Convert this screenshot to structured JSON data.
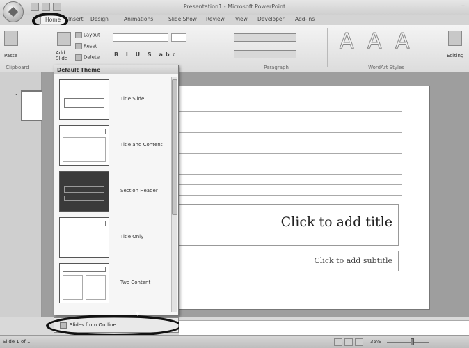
{
  "app": {
    "window_title": "Presentation1 - Microsoft PowerPoint"
  },
  "tabs": [
    "Home",
    "Insert",
    "Design",
    "Animations",
    "Slide Show",
    "Review",
    "View",
    "Developer",
    "Add-Ins"
  ],
  "ribbon": {
    "paste_label": "Paste",
    "add_slide_label": "Add Slide",
    "layout_label": "Layout",
    "reset_label": "Reset",
    "delete_label": "Delete",
    "group_labels": [
      "Clipboard",
      "Paragraph",
      "WordArt Styles"
    ],
    "format_buttons": "B I U S abc",
    "wordart_glyph": "A",
    "editing_label": "Editing"
  },
  "gallery": {
    "header": "Default Theme",
    "layouts": [
      {
        "label": "Title Slide",
        "thumb_style": "light"
      },
      {
        "label": "Title and Content",
        "thumb_style": "light"
      },
      {
        "label": "Section Header",
        "thumb_style": "dark"
      },
      {
        "label": "Title Only",
        "thumb_style": "light"
      },
      {
        "label": "Two Content",
        "thumb_style": "light"
      }
    ],
    "footer_item": "Slides from Outline..."
  },
  "slide": {
    "title_placeholder": "Click to add title",
    "subtitle_placeholder": "Click to add subtitle"
  },
  "thumbnail_number": "1",
  "status": {
    "slide_counter": "Slide 1 of 1",
    "zoom": "35%"
  }
}
